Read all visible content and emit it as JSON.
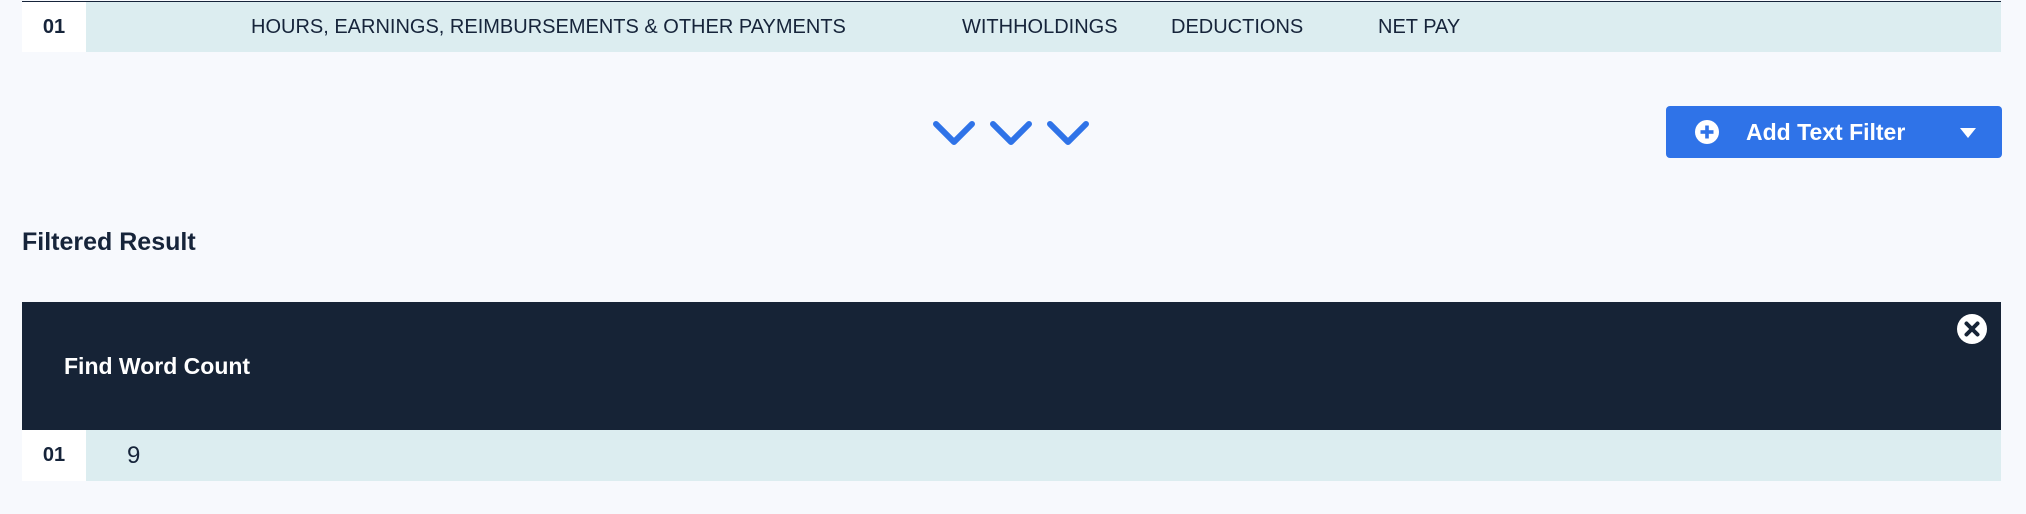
{
  "header_row": {
    "number": "01",
    "columns": {
      "hours": "HOURS, EARNINGS, REIMBURSEMENTS & OTHER PAYMENTS",
      "withholdings": "WITHHOLDINGS",
      "deductions": "DEDUCTIONS",
      "net_pay": "NET PAY"
    }
  },
  "toolbar": {
    "expand_icons": [
      "chevron-down-icon",
      "chevron-down-icon",
      "chevron-down-icon"
    ],
    "add_filter_label": "Add Text Filter",
    "add_filter_icon": "plus-circle-icon",
    "dropdown_icon": "caret-down-icon"
  },
  "filtered_result": {
    "title": "Filtered Result",
    "panel": {
      "title": "Find Word Count",
      "close_icon": "close-circle-icon"
    },
    "row": {
      "number": "01",
      "value": "9"
    }
  },
  "colors": {
    "accent": "#2f73e8",
    "panel_bg": "#162336",
    "row_bg": "#dcedf0",
    "page_bg": "#f7f9fd",
    "text": "#16243a"
  }
}
